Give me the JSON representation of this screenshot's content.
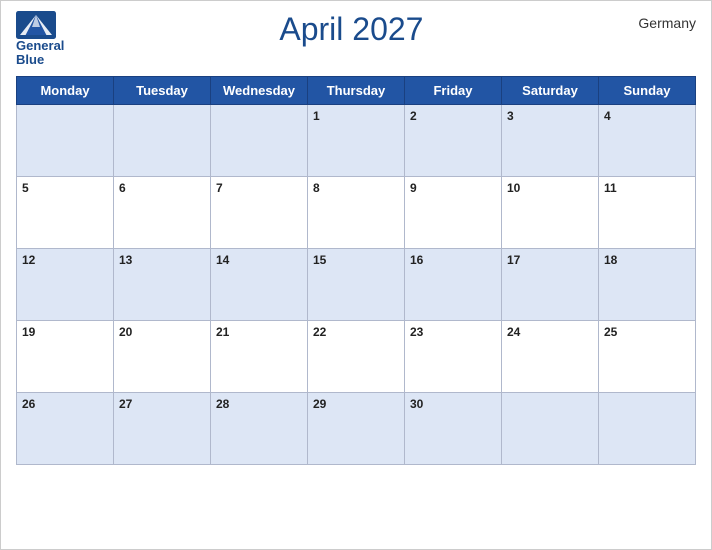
{
  "header": {
    "logo_line1": "General",
    "logo_line2": "Blue",
    "title": "April 2027",
    "country": "Germany"
  },
  "weekdays": [
    "Monday",
    "Tuesday",
    "Wednesday",
    "Thursday",
    "Friday",
    "Saturday",
    "Sunday"
  ],
  "weeks": [
    [
      {
        "day": "",
        "empty": true
      },
      {
        "day": "",
        "empty": true
      },
      {
        "day": "",
        "empty": true
      },
      {
        "day": "1",
        "empty": false
      },
      {
        "day": "2",
        "empty": false
      },
      {
        "day": "3",
        "empty": false
      },
      {
        "day": "4",
        "empty": false
      }
    ],
    [
      {
        "day": "5",
        "empty": false
      },
      {
        "day": "6",
        "empty": false
      },
      {
        "day": "7",
        "empty": false
      },
      {
        "day": "8",
        "empty": false
      },
      {
        "day": "9",
        "empty": false
      },
      {
        "day": "10",
        "empty": false
      },
      {
        "day": "11",
        "empty": false
      }
    ],
    [
      {
        "day": "12",
        "empty": false
      },
      {
        "day": "13",
        "empty": false
      },
      {
        "day": "14",
        "empty": false
      },
      {
        "day": "15",
        "empty": false
      },
      {
        "day": "16",
        "empty": false
      },
      {
        "day": "17",
        "empty": false
      },
      {
        "day": "18",
        "empty": false
      }
    ],
    [
      {
        "day": "19",
        "empty": false
      },
      {
        "day": "20",
        "empty": false
      },
      {
        "day": "21",
        "empty": false
      },
      {
        "day": "22",
        "empty": false
      },
      {
        "day": "23",
        "empty": false
      },
      {
        "day": "24",
        "empty": false
      },
      {
        "day": "25",
        "empty": false
      }
    ],
    [
      {
        "day": "26",
        "empty": false
      },
      {
        "day": "27",
        "empty": false
      },
      {
        "day": "28",
        "empty": false
      },
      {
        "day": "29",
        "empty": false
      },
      {
        "day": "30",
        "empty": false
      },
      {
        "day": "",
        "empty": true
      },
      {
        "day": "",
        "empty": true
      }
    ]
  ],
  "blue_rows": [
    0,
    2,
    4
  ],
  "colors": {
    "header_bg": "#2255a4",
    "alt_row_bg": "#dde6f5",
    "title_color": "#1a4b8c"
  }
}
